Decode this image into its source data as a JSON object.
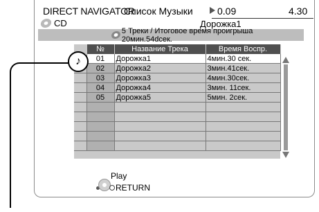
{
  "header": {
    "app_name": "DIRECT NAVIGATOR",
    "title": "Список Музыки",
    "time_elapsed": "0.09",
    "time_total": "4.30"
  },
  "disc": {
    "label": "CD",
    "current_track": "Дорожка1"
  },
  "info_bar": {
    "text": "5 Треки / Итоговое время проигрыша 20мин.54dсек."
  },
  "table": {
    "columns": [
      "№",
      "Название Трека",
      "Время Воспр."
    ],
    "rows": [
      {
        "num": "01",
        "name": "Дорожка1",
        "time": "4мин.30 сек."
      },
      {
        "num": "02",
        "name": "Дорожка2",
        "time": "3мин.41сек."
      },
      {
        "num": "03",
        "name": "Дорожка3",
        "time": "4мин.30сек."
      },
      {
        "num": "04",
        "name": "Дорожка4",
        "time": "3мин. 11сек."
      },
      {
        "num": "05",
        "name": "Дорожка5",
        "time": "5мин.  2сек."
      }
    ],
    "selected_row": 0,
    "playing_icon": "music-note-icon",
    "playing_symbol": "♪"
  },
  "footer": {
    "play_label": "Play",
    "return_label": "RETURN"
  },
  "colors": {
    "header_bg": "#4f4f4f",
    "row_bg": "#c9c9c9",
    "selected_row_bg": "#ffffff",
    "info_bar_bg": "#bdbdbd"
  }
}
